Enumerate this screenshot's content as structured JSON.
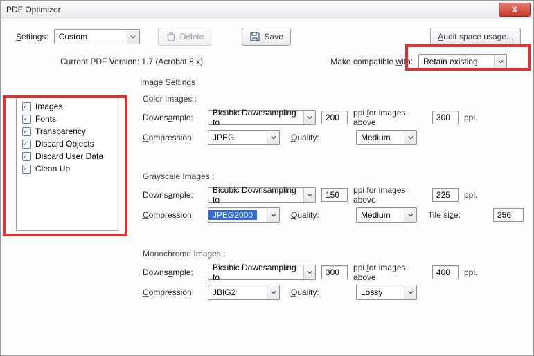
{
  "window": {
    "title": "PDF Optimizer",
    "close": "X"
  },
  "toolbar": {
    "settings_label": "Settings:",
    "settings_value": "Custom",
    "delete_label": "Delete",
    "save_label": "Save",
    "audit_label": "Audit space usage..."
  },
  "version": {
    "current_label": "Current PDF Version:",
    "current_value": "1.7 (Acrobat 8.x)",
    "compat_label": "Make compatible with:",
    "compat_value": "Retain existing"
  },
  "sidebar": {
    "items": [
      {
        "label": "Images",
        "checked": true
      },
      {
        "label": "Fonts",
        "checked": true
      },
      {
        "label": "Transparency",
        "checked": true
      },
      {
        "label": "Discard Objects",
        "checked": true
      },
      {
        "label": "Discard User Data",
        "checked": true
      },
      {
        "label": "Clean Up",
        "checked": true
      }
    ]
  },
  "image_settings": {
    "title": "Image Settings",
    "color": {
      "title": "Color Images :",
      "downsample_label": "Downsample:",
      "downsample_value": "Bicubic Downsampling to",
      "ppi": "200",
      "above_label": "ppi for images above",
      "above_ppi": "300",
      "ppi_suffix": "ppi.",
      "compression_label": "Compression:",
      "compression_value": "JPEG",
      "quality_label": "Quality:",
      "quality_value": "Medium"
    },
    "gray": {
      "title": "Grayscale Images :",
      "downsample_label": "Downsample:",
      "downsample_value": "Bicubic Downsampling to",
      "ppi": "150",
      "above_label": "ppi for images above",
      "above_ppi": "225",
      "ppi_suffix": "ppi.",
      "compression_label": "Compression:",
      "compression_value": "JPEG2000",
      "quality_label": "Quality:",
      "quality_value": "Medium",
      "tile_label": "Tile size:",
      "tile_value": "256"
    },
    "mono": {
      "title": "Monochrome Images :",
      "downsample_label": "Downsample:",
      "downsample_value": "Bicubic Downsampling to",
      "ppi": "300",
      "above_label": "ppi for images above",
      "above_ppi": "400",
      "ppi_suffix": "ppi.",
      "compression_label": "Compression:",
      "compression_value": "JBIG2",
      "quality_label": "Quality:",
      "quality_value": "Lossy"
    }
  }
}
